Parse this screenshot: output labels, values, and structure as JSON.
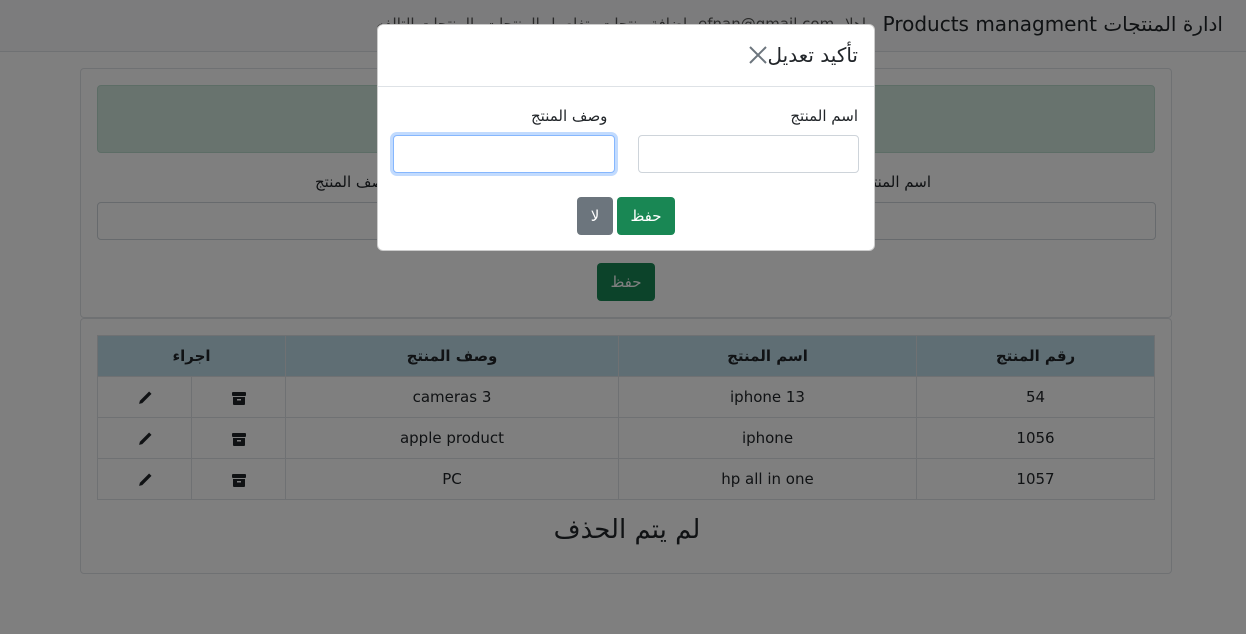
{
  "navbar": {
    "brand": "ادارة المنتجات Products managment",
    "links": [
      "اهلا",
      "efnan@gmail.com",
      "اضافة منتجات",
      "تفاصيل المنتجات",
      "المنتجات التالفه"
    ]
  },
  "form": {
    "name_label": "اسم المنتج",
    "desc_label": "وصف المنتج",
    "save_label": "حفظ"
  },
  "table": {
    "headers": [
      "رقم المنتج",
      "اسم المنتج",
      "وصف المنتج",
      "اجراء"
    ],
    "rows": [
      {
        "id": "54",
        "name": "iphone 13",
        "desc": "cameras 3"
      },
      {
        "id": "1056",
        "name": "iphone",
        "desc": "apple product"
      },
      {
        "id": "1057",
        "name": "hp all in one",
        "desc": "PC"
      }
    ],
    "footer": "لم يتم الحذف"
  },
  "modal": {
    "title": "تأكيد تعديل",
    "name_label": "اسم المنتج",
    "desc_label": "وصف المنتج",
    "save_label": "حفظ",
    "cancel_label": "لا"
  },
  "icons": {
    "edit": "pencil-icon",
    "archive": "archive-icon",
    "close": "close-icon"
  }
}
